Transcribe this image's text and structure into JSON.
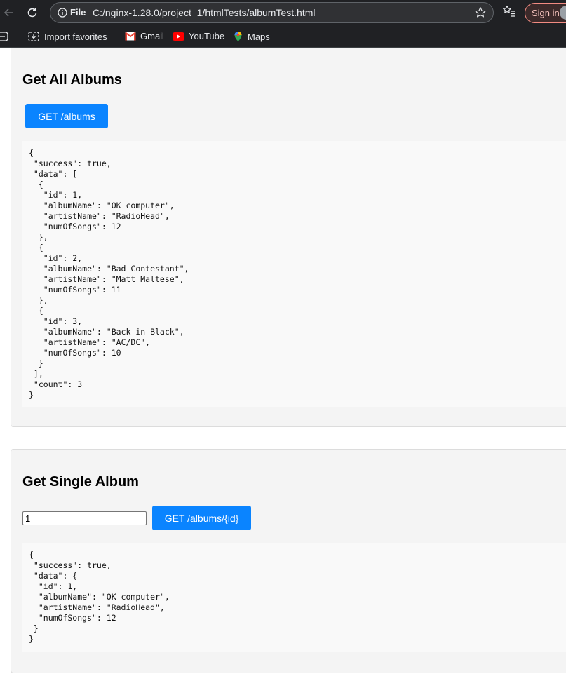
{
  "browser": {
    "scheme_label": "File",
    "url": "C:/nginx-1.28.0/project_1/htmlTests/albumTest.html",
    "signin_label": "Sign in",
    "bookmarks": [
      "Import favorites",
      "Gmail",
      "YouTube",
      "Maps"
    ]
  },
  "page": {
    "all_albums": {
      "heading": "Get All Albums",
      "button_label": "GET /albums",
      "response": "{\n \"success\": true,\n \"data\": [\n  {\n   \"id\": 1,\n   \"albumName\": \"OK computer\",\n   \"artistName\": \"RadioHead\",\n   \"numOfSongs\": 12\n  },\n  {\n   \"id\": 2,\n   \"albumName\": \"Bad Contestant\",\n   \"artistName\": \"Matt Maltese\",\n   \"numOfSongs\": 11\n  },\n  {\n   \"id\": 3,\n   \"albumName\": \"Back in Black\",\n   \"artistName\": \"AC/DC\",\n   \"numOfSongs\": 10\n  }\n ],\n \"count\": 3\n}"
    },
    "single_album": {
      "heading": "Get Single Album",
      "input_value": "1",
      "button_label": "GET /albums/{id}",
      "response": "{\n \"success\": true,\n \"data\": {\n  \"id\": 1,\n  \"albumName\": \"OK computer\",\n  \"artistName\": \"RadioHead\",\n  \"numOfSongs\": 12\n }\n}"
    }
  }
}
